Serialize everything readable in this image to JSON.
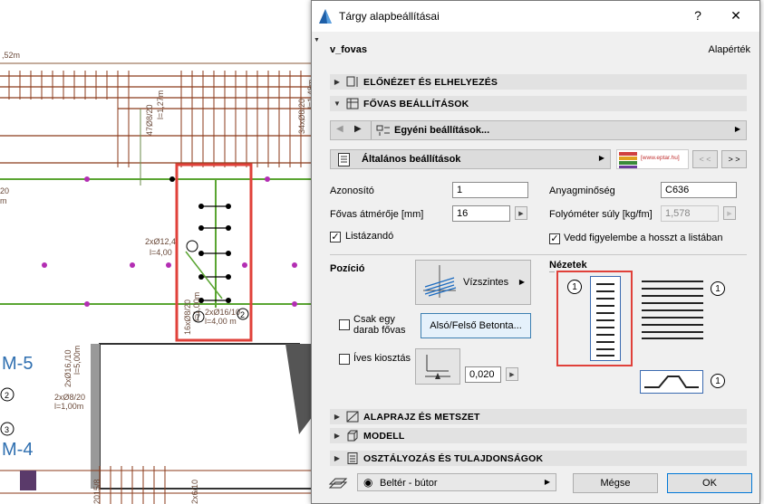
{
  "background": {
    "dimension_top": ",52m",
    "labels": {
      "bar_48": "47Ø8/20",
      "bar_48_len": "l=1,27m",
      "bar_34": "34xØ8/20",
      "bar_34_len": "l=1,48m",
      "left_20": "20",
      "left_m": "m",
      "mid_label": "2xØ12,4",
      "mid_len": "l=4,00",
      "vert_16": "16xØ8/20",
      "vert_16_len": "l=1,00m",
      "vert_2": "2xØ16/10",
      "vert_2_len": "l=4,00 m",
      "left_2": "2xØ16,/10",
      "left_2_len": "l=5,00m",
      "left_28": "2xØ8/20",
      "left_28_len": "l=1,00m",
      "bot_2015": "2015/8",
      "bot_216": "2x6/10",
      "m5": "M-5",
      "m4": "M-4",
      "c7": "7",
      "c2": "2",
      "c3": "3",
      "c2b": "2"
    },
    "red_box_color": "#e0413a"
  },
  "dialog": {
    "title": "Tárgy alapbeállításai",
    "help_button": "?",
    "close_button": "✕",
    "object_name": "v_fovas",
    "default_label": "Alapérték",
    "sections": {
      "preview": "ELŐNÉZET ÉS ELHELYEZÉS",
      "settings": "FŐVAS BEÁLLÍTÁSOK",
      "floor_plan": "ALAPRAJZ ÉS METSZET",
      "model": "MODELL",
      "classification": "OSZTÁLYOZÁS ÉS TULAJDONSÁGOK"
    },
    "custom_settings": "Egyéni beállítások...",
    "general_settings": "Általános beállítások",
    "logo_url": "[www.eptar.hu]",
    "nav_prev": "< <",
    "nav_next": "> >",
    "fields": {
      "id_label": "Azonosító",
      "id_value": "1",
      "material_label": "Anyagminőség",
      "material_value": "C636",
      "diameter_label": "Fővas átmérője [mm]",
      "diameter_value": "16",
      "weight_label": "Folyóméter súly [kg/fm]",
      "weight_value": "1,578",
      "list_label": "Listázandó",
      "consider_label": "Vedd figyelembe a hosszt a listában"
    },
    "position": {
      "label": "Pozíció",
      "orientation": "Vízszintes",
      "single_label_1": "Csak egy",
      "single_label_2": "darab fővas",
      "layer_button": "Alsó/Felső Betonta...",
      "curved_label": "Íves kiosztás",
      "curved_value": "0,020"
    },
    "views": {
      "label": "Nézetek",
      "num1": "1",
      "num2": "1",
      "num3": "1"
    },
    "footer": {
      "layer": "Beltér - bútor",
      "cancel": "Mégse",
      "ok": "OK"
    }
  }
}
